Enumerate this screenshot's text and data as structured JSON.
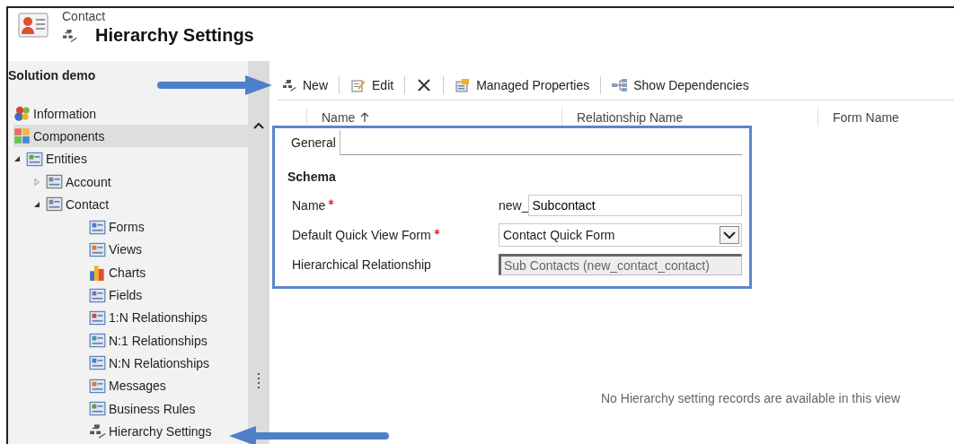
{
  "header": {
    "entity": "Contact",
    "title": "Hierarchy Settings"
  },
  "sidebar": {
    "title": "Solution demo",
    "items": [
      {
        "label": "Information",
        "selected": false
      },
      {
        "label": "Components",
        "selected": true
      },
      {
        "label": "Entities",
        "selected": false,
        "expanded": true,
        "children": [
          {
            "label": "Account",
            "selected": false,
            "expanded": false
          },
          {
            "label": "Contact",
            "selected": false,
            "expanded": true,
            "children": [
              {
                "label": "Forms",
                "selected": false
              },
              {
                "label": "Views",
                "selected": false
              },
              {
                "label": "Charts",
                "selected": false
              },
              {
                "label": "Fields",
                "selected": false
              },
              {
                "label": "1:N Relationships",
                "selected": false
              },
              {
                "label": "N:1 Relationships",
                "selected": false
              },
              {
                "label": "N:N Relationships",
                "selected": false
              },
              {
                "label": "Messages",
                "selected": false
              },
              {
                "label": "Business Rules",
                "selected": false
              },
              {
                "label": "Hierarchy Settings",
                "selected": false
              }
            ]
          }
        ]
      }
    ]
  },
  "toolbar": [
    {
      "kind": "new",
      "label": "New"
    },
    {
      "kind": "edit",
      "label": "Edit"
    },
    {
      "kind": "delete"
    },
    {
      "kind": "properties",
      "label": "Managed Properties"
    },
    {
      "kind": "dependencies",
      "label": "Show Dependencies"
    }
  ],
  "table": {
    "columns": [
      {
        "label": "Name",
        "sorted": true
      },
      {
        "label": "Relationship Name"
      },
      {
        "label": "Form Name"
      }
    ],
    "empty_message": "No Hierarchy setting records are available in this view"
  },
  "form": {
    "tabs": [
      {
        "label": "General",
        "selected": true
      }
    ],
    "section": "Schema",
    "fields": [
      {
        "kind": "prefixed-text",
        "label": "Name",
        "required": true,
        "prefix": "new_",
        "value": "Subcontact"
      },
      {
        "kind": "select",
        "label": "Default Quick View Form",
        "required": true,
        "value": "Contact Quick Form"
      },
      {
        "kind": "readonly",
        "label": "Hierarchical Relationship",
        "required": false,
        "value": "Sub Contacts (new_contact_contact)"
      }
    ]
  }
}
